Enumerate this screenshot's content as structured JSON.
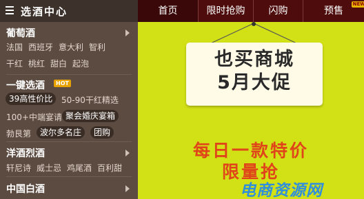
{
  "header": {
    "category_title": "选酒中心",
    "nav": [
      {
        "label": "首页",
        "active": true
      },
      {
        "label": "限时抢购"
      },
      {
        "label": "闪购"
      },
      {
        "label": "预售",
        "badge": "NEW"
      }
    ]
  },
  "sidebar": {
    "groups": [
      {
        "title": "葡萄酒",
        "links_row1": [
          "法国",
          "西班牙",
          "意大利",
          "智利"
        ],
        "links_row2": [
          "干红",
          "桃红",
          "甜白",
          "起泡"
        ]
      },
      {
        "title": "一键选酒",
        "hot": "HOT",
        "tags_row1": [
          "39高性价比",
          "50-90干红精选"
        ],
        "tags_row2": [
          "100+中端宴请",
          "聚会婚庆宴箱"
        ],
        "tags_row3": [
          "勃艮第",
          "波尔多名庄",
          "团购"
        ]
      },
      {
        "title": "洋酒烈酒",
        "links": [
          "轩尼诗",
          "威士忌",
          "鸡尾酒",
          "百利甜"
        ]
      },
      {
        "title": "中国白酒"
      }
    ]
  },
  "banner": {
    "sign_line1": "也买商城",
    "sign_line2": "5月大促",
    "promo_line1": "每日一款特价",
    "promo_line2": "限量抢",
    "watermark": "电商资源网",
    "colors": {
      "background": "#d2e016",
      "promo": "#e0451a",
      "watermark": "#2f8fdc"
    }
  }
}
